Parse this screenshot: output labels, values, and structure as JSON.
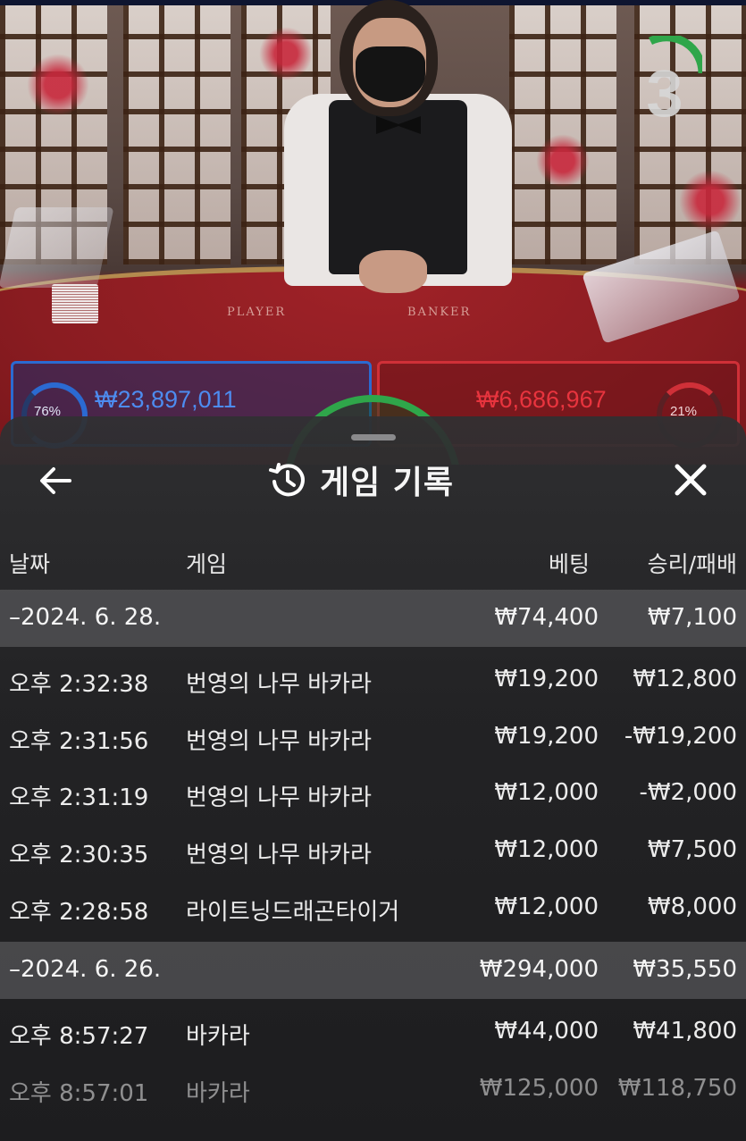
{
  "stream": {
    "countdown": "3",
    "table_labels": {
      "player": "PLAYER",
      "banker": "BANKER"
    },
    "player_bet": {
      "amount": "₩23,897,011",
      "percent": "76%"
    },
    "banker_bet": {
      "amount": "₩6,686,967",
      "percent": "21%"
    },
    "colors": {
      "player": "#2b6ad1",
      "banker": "#d03038",
      "timer": "#2fa64a"
    }
  },
  "sheet": {
    "title": "게임 기록",
    "back_icon": "arrow-left-icon",
    "history_icon": "history-icon",
    "close_icon": "close-icon",
    "columns": {
      "date": "날짜",
      "game": "게임",
      "bet": "베팅",
      "winloss": "승리/패배"
    },
    "groups": [
      {
        "date": "–2024. 6. 28.",
        "bet_total": "₩74,400",
        "winloss_total": "₩7,100",
        "rows": [
          {
            "time": "오후 2:32:38",
            "game": "번영의 나무 바카라",
            "bet": "₩19,200",
            "winloss": "₩12,800"
          },
          {
            "time": "오후 2:31:56",
            "game": "번영의 나무 바카라",
            "bet": "₩19,200",
            "winloss": "-₩19,200"
          },
          {
            "time": "오후 2:31:19",
            "game": "번영의 나무 바카라",
            "bet": "₩12,000",
            "winloss": "-₩2,000"
          },
          {
            "time": "오후 2:30:35",
            "game": "번영의 나무 바카라",
            "bet": "₩12,000",
            "winloss": "₩7,500"
          },
          {
            "time": "오후 2:28:58",
            "game": "라이트닝드래곤타이거",
            "bet": "₩12,000",
            "winloss": "₩8,000"
          }
        ]
      },
      {
        "date": "–2024. 6. 26.",
        "bet_total": "₩294,000",
        "winloss_total": "₩35,550",
        "rows": [
          {
            "time": "오후 8:57:27",
            "game": "바카라",
            "bet": "₩44,000",
            "winloss": "₩41,800"
          },
          {
            "time": "오후 8:57:01",
            "game": "바카라",
            "bet": "₩125,000",
            "winloss": "₩118,750"
          }
        ]
      }
    ]
  }
}
